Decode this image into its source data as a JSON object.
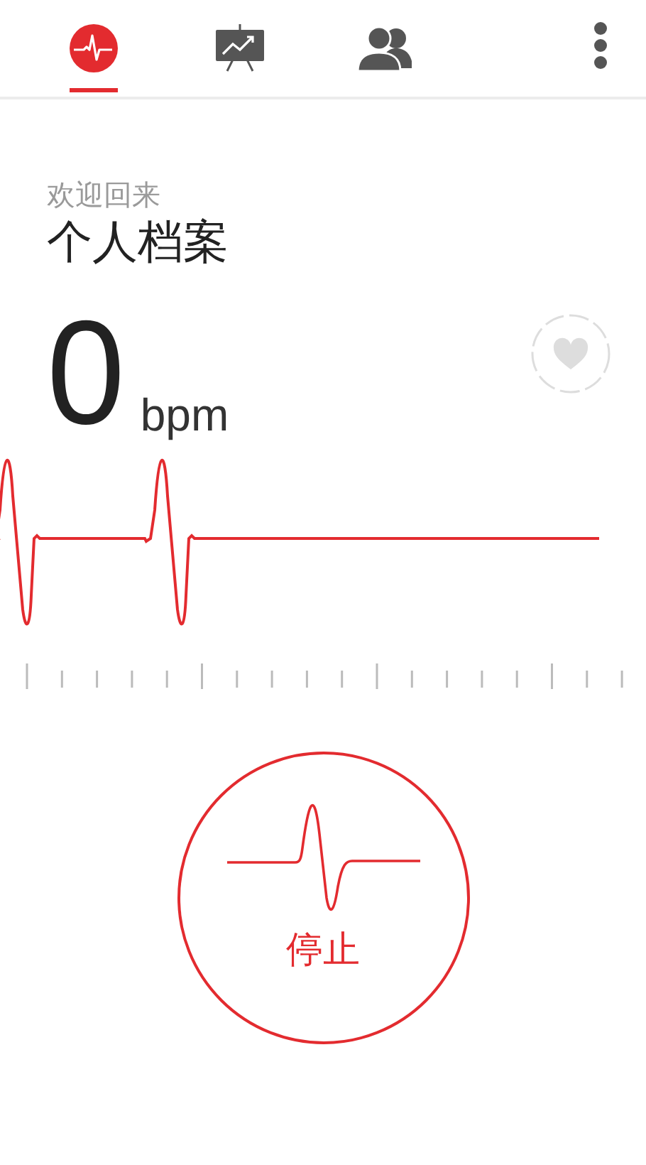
{
  "tabs": [
    {
      "kind": "pulse",
      "selected": true
    },
    {
      "kind": "chart",
      "selected": false
    },
    {
      "kind": "people",
      "selected": false
    }
  ],
  "greeting": "欢迎回来",
  "profile_title": "个人档案",
  "heart_rate": {
    "value": "0",
    "unit": "bpm"
  },
  "stop_button": {
    "label": "停止"
  }
}
